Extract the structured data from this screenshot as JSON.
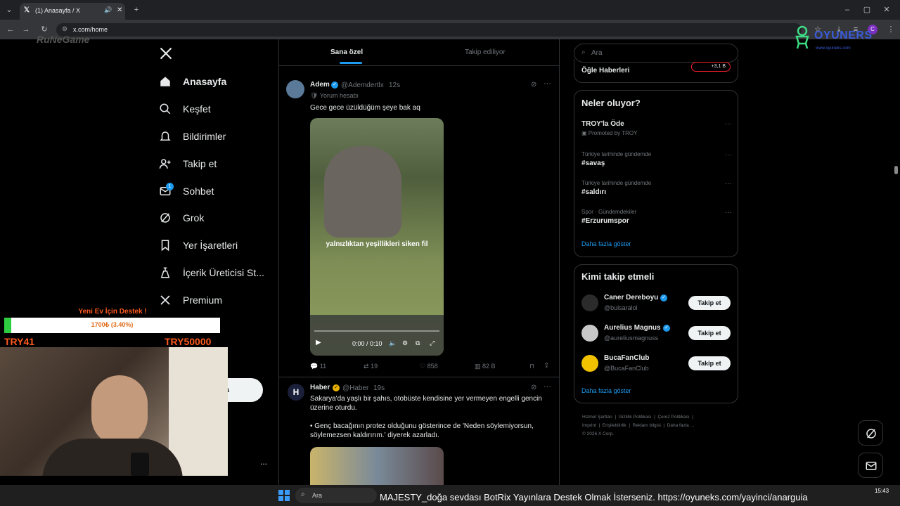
{
  "browser": {
    "tab_title": "(1) Anasayfa / X",
    "url": "x.com/home",
    "new_tab": "+",
    "profile_initial": "C"
  },
  "overlay": {
    "brand_left": "RuNeGame",
    "brand_right": "OYUNERS",
    "brand_right_sub": "www.oyuneks.com",
    "donation_title": "Yeni Ev İçin Destek !",
    "donation_progress": "1700₺ (3.40%)",
    "donation_fraction": 0.034,
    "donation_min": "TRY41",
    "donation_max": "TRY50000",
    "ticker": "MAJESTY_doğa sevdası   BotRix  Yayınlara Destek Olmak İsterseniz. https://oyuneks.com/yayinci/anarguia"
  },
  "nav": {
    "items": [
      {
        "label": "Anasayfa",
        "icon": "home-icon"
      },
      {
        "label": "Keşfet",
        "icon": "search-icon"
      },
      {
        "label": "Bildirimler",
        "icon": "bell-icon"
      },
      {
        "label": "Takip et",
        "icon": "follow-icon"
      },
      {
        "label": "Sohbet",
        "icon": "mail-icon"
      },
      {
        "label": "Grok",
        "icon": "grok-icon"
      },
      {
        "label": "Yer İşaretleri",
        "icon": "bookmark-icon"
      },
      {
        "label": "İçerik Üreticisi St...",
        "icon": "creator-icon"
      },
      {
        "label": "Premium",
        "icon": "x-logo-icon"
      }
    ],
    "chat_badge": "1",
    "post_button_partial": "nla",
    "more": "..."
  },
  "feed": {
    "tabs": [
      "Sana özel",
      "Takip ediliyor"
    ],
    "tweet1": {
      "name": "Adem",
      "handle": "@Ademdertlx",
      "time": "12s",
      "sub": "Yorum hesabı",
      "text": "Gece gece üzüldüğüm şeye bak aq",
      "video_caption": "yalnızlıktan yeşillikleri siken fil",
      "video_time": "0:00 / 0:10",
      "replies": "11",
      "reposts": "19",
      "likes": "858",
      "views": "82 B"
    },
    "tweet2": {
      "name": "Haber",
      "handle": "@Haber",
      "time": "19s",
      "avatar_letter": "H",
      "text1": "Sakarya'da yaşlı bir şahıs, otobüste kendisine yer vermeyen engelli gencin üzerine oturdu.",
      "text2": "• Genç bacağının protez olduğunu gösterince de 'Neden söylemiyorsun, söylemezsen kaldırırım.' diyerek azarladı."
    }
  },
  "right": {
    "search_placeholder": "Ara",
    "news_title": "Öğle Haberleri",
    "news_badge": "+3,1 B",
    "trends_title": "Neler oluyor?",
    "trends": [
      {
        "sub": "",
        "title": "TROY'la Öde",
        "promo": "Promoted by TROY"
      },
      {
        "sub": "Türkiye tarihinde gündemde",
        "title": "#savaş"
      },
      {
        "sub": "Türkiye tarihinde gündemde",
        "title": "#saldırı"
      },
      {
        "sub": "Spor · Gündemdekiler",
        "title": "#Erzurumspor"
      }
    ],
    "show_more": "Daha fazla göster",
    "who_title": "Kimi takip etmeli",
    "who": [
      {
        "name": "Caner Dereboyu",
        "handle": "@bulsaralol"
      },
      {
        "name": "Aurelius Magnus",
        "handle": "@aureliusmagnuss"
      },
      {
        "name": "BucaFanClub",
        "handle": "@BucaFanClub"
      }
    ],
    "follow_label": "Takip et",
    "footer": [
      "Hizmet Şartları",
      "Gizlilik Politikası",
      "Çerez Politikası",
      "Imprint",
      "Erişilebilirlik",
      "Reklam bilgisi",
      "Daha fazla ..."
    ],
    "copyright": "© 2026 X Corp."
  },
  "taskbar": {
    "search": "Ara",
    "time": "15:43"
  }
}
